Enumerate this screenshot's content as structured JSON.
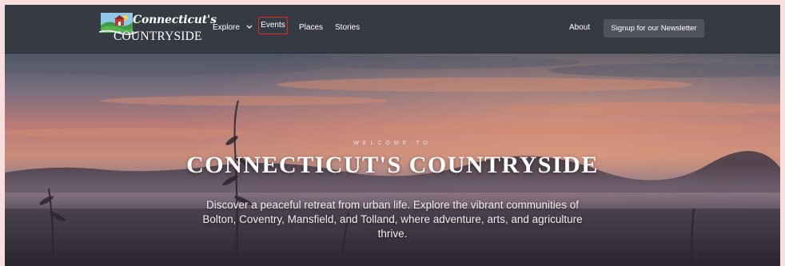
{
  "site": {
    "logo_script": "Connecticut's",
    "logo_sub": "COUNTRYSIDE"
  },
  "nav": {
    "explore": "Explore",
    "events": "Events",
    "places": "Places",
    "stories": "Stories",
    "about": "About",
    "newsletter": "Signup for our Newsletter"
  },
  "hero": {
    "welcome": "WELCOME TO",
    "title": "CONNECTICUT'S COUNTRYSIDE",
    "subtitle": "Discover a peaceful retreat from urban life. Explore the vibrant communities of Bolton, Coventry, Mansfield, and Tolland, where adventure, arts, and agriculture thrive."
  },
  "colors": {
    "page_border": "#f9dede",
    "navbar": "#363a43",
    "button": "#4e535d",
    "highlight": "#e0262b"
  },
  "icons": {
    "dropdown": "chevron-down-icon",
    "logo": "farm-landscape-icon"
  }
}
